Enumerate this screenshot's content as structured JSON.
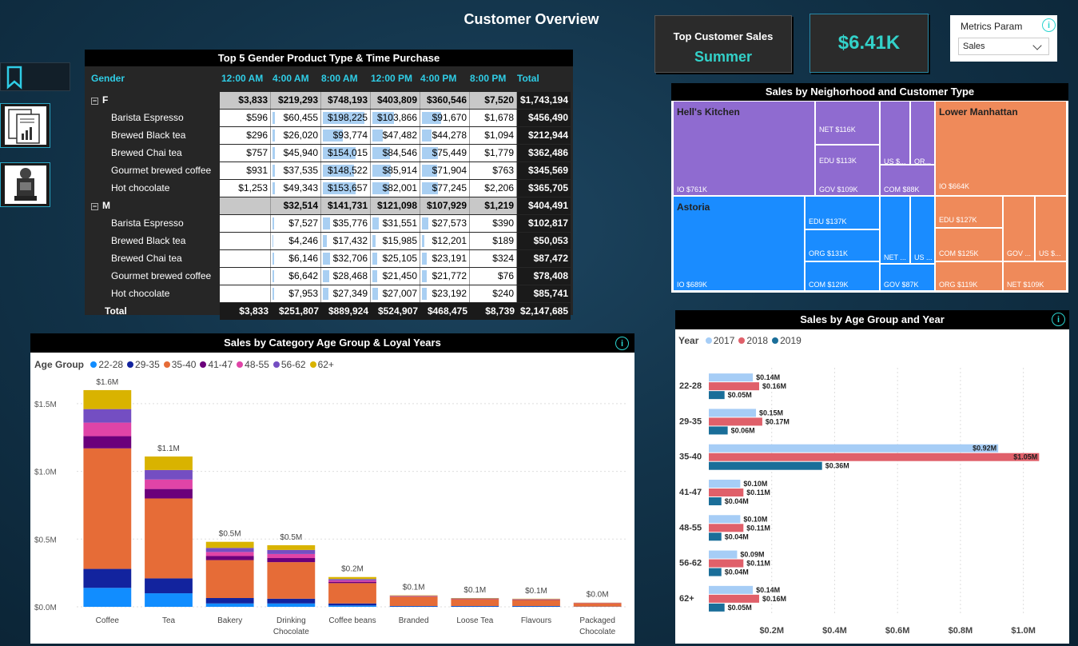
{
  "page_title": "Customer Overview",
  "kpi": {
    "top_customer_label": "Top Customer Sales",
    "top_customer_value": "Summer",
    "amount": "$6.41K"
  },
  "metrics_param": {
    "label": "Metrics Param",
    "selected": "Sales"
  },
  "matrix": {
    "title": "Top 5 Gender Product Type & Time Purchase",
    "row_header": "Gender",
    "columns": [
      "12:00 AM",
      "4:00 AM",
      "8:00 AM",
      "12:00 PM",
      "4:00 PM",
      "8:00 PM",
      "Total"
    ],
    "groups": [
      {
        "name": "F",
        "totals": [
          "$3,833",
          "$219,293",
          "$748,193",
          "$403,809",
          "$360,546",
          "$7,520",
          "$1,743,194"
        ],
        "rows": [
          {
            "label": "Barista Espresso",
            "values": [
              "$596",
              "$60,455",
              "$198,225",
              "$103,866",
              "$91,670",
              "$1,678",
              "$456,490"
            ],
            "bars": [
              0,
              0.05,
              0.9,
              0.47,
              0.41,
              0,
              0
            ]
          },
          {
            "label": "Brewed Black tea",
            "values": [
              "$296",
              "$26,020",
              "$93,774",
              "$47,482",
              "$44,278",
              "$1,094",
              "$212,944"
            ],
            "bars": [
              0,
              0.05,
              0.43,
              0.22,
              0.2,
              0,
              0
            ]
          },
          {
            "label": "Brewed Chai tea",
            "values": [
              "$757",
              "$45,940",
              "$154,015",
              "$84,546",
              "$75,449",
              "$1,779",
              "$362,486"
            ],
            "bars": [
              0,
              0.05,
              0.7,
              0.38,
              0.34,
              0,
              0
            ]
          },
          {
            "label": "Gourmet brewed coffee",
            "values": [
              "$931",
              "$37,535",
              "$148,522",
              "$85,914",
              "$71,904",
              "$763",
              "$345,569"
            ],
            "bars": [
              0,
              0.05,
              0.68,
              0.39,
              0.33,
              0,
              0
            ]
          },
          {
            "label": "Hot chocolate",
            "values": [
              "$1,253",
              "$49,343",
              "$153,657",
              "$82,001",
              "$77,245",
              "$2,206",
              "$365,705"
            ],
            "bars": [
              0,
              0.05,
              0.7,
              0.37,
              0.35,
              0,
              0
            ]
          }
        ]
      },
      {
        "name": "M",
        "totals": [
          "",
          "$32,514",
          "$141,731",
          "$121,098",
          "$107,929",
          "$1,219",
          "$404,491"
        ],
        "rows": [
          {
            "label": "Barista Espresso",
            "values": [
              "",
              "$7,527",
              "$35,776",
              "$31,551",
              "$27,573",
              "$390",
              "$102,817"
            ],
            "bars": [
              0,
              0.03,
              0.16,
              0.14,
              0.13,
              0,
              0
            ]
          },
          {
            "label": "Brewed Black tea",
            "values": [
              "",
              "$4,246",
              "$17,432",
              "$15,985",
              "$12,201",
              "$189",
              "$50,053"
            ],
            "bars": [
              0,
              0.02,
              0.08,
              0.07,
              0.06,
              0,
              0
            ]
          },
          {
            "label": "Brewed Chai tea",
            "values": [
              "",
              "$6,146",
              "$32,706",
              "$25,105",
              "$23,191",
              "$324",
              "$87,472"
            ],
            "bars": [
              0,
              0.03,
              0.15,
              0.11,
              0.11,
              0,
              0
            ]
          },
          {
            "label": "Gourmet brewed coffee",
            "values": [
              "",
              "$6,642",
              "$28,468",
              "$21,450",
              "$21,772",
              "$76",
              "$78,408"
            ],
            "bars": [
              0,
              0.03,
              0.13,
              0.1,
              0.1,
              0,
              0
            ]
          },
          {
            "label": "Hot chocolate",
            "values": [
              "",
              "$7,953",
              "$27,349",
              "$27,007",
              "$23,192",
              "$240",
              "$85,741"
            ],
            "bars": [
              0,
              0.04,
              0.12,
              0.12,
              0.11,
              0,
              0
            ]
          }
        ]
      }
    ],
    "total_label": "Total",
    "grand_totals": [
      "$3,833",
      "$251,807",
      "$889,924",
      "$524,907",
      "$468,475",
      "$8,739",
      "$2,147,685"
    ]
  },
  "treemap": {
    "title": "Sales by Neighorhood and Customer Type",
    "areas": [
      {
        "name": "Hell's Kitchen",
        "color": "#8f6bd0",
        "cells": [
          "IO $761K",
          "NET $116K",
          "EDU $113K",
          "GOV $109K",
          "US $...",
          "OR...",
          "COM $88K"
        ]
      },
      {
        "name": "Astoria",
        "color": "#1a8cff",
        "cells": [
          "IO $689K",
          "EDU $137K",
          "ORG $131K",
          "COM $129K",
          "NET ...",
          "US ...",
          "GOV $87K"
        ]
      },
      {
        "name": "Lower Manhattan",
        "color": "#ef8a5a",
        "cells": [
          "IO $664K",
          "EDU $127K",
          "COM $125K",
          "GOV ...",
          "US $...",
          "ORG $119K",
          "NET $109K"
        ]
      }
    ]
  },
  "info_icon": "i",
  "chart_data": [
    {
      "type": "bar",
      "stacked": true,
      "title": "Sales by Category Age Group & Loyal Years",
      "legend_title": "Age Group",
      "legend_position": "top-left",
      "categories": [
        "Coffee",
        "Tea",
        "Bakery",
        "Drinking Chocolate",
        "Coffee beans",
        "Branded",
        "Loose Tea",
        "Flavours",
        "Packaged Chocolate"
      ],
      "totals_labels": [
        "$1.6M",
        "$1.1M",
        "$0.5M",
        "$0.5M",
        "$0.2M",
        "$0.1M",
        "$0.1M",
        "$0.1M",
        "$0.0M"
      ],
      "ylim": [
        0,
        1700000
      ],
      "yticks": [
        "$0.0M",
        "$0.5M",
        "$1.0M",
        "$1.5M"
      ],
      "ytick_values": [
        0,
        500000,
        1000000,
        1500000
      ],
      "grid": true,
      "series": [
        {
          "name": "22-28",
          "color": "#118dff",
          "values": [
            140000,
            100000,
            25000,
            25000,
            10000,
            3000,
            3000,
            3000,
            1000
          ]
        },
        {
          "name": "29-35",
          "color": "#12239e",
          "values": [
            140000,
            110000,
            40000,
            35000,
            15000,
            3000,
            3000,
            3000,
            1000
          ]
        },
        {
          "name": "35-40",
          "color": "#e66c37",
          "values": [
            890000,
            590000,
            280000,
            270000,
            150000,
            70000,
            50000,
            45000,
            25000
          ]
        },
        {
          "name": "41-47",
          "color": "#6b007b",
          "values": [
            90000,
            70000,
            30000,
            30000,
            10000,
            2000,
            2000,
            2000,
            1000
          ]
        },
        {
          "name": "48-55",
          "color": "#e044a7",
          "values": [
            100000,
            70000,
            30000,
            30000,
            10000,
            2000,
            2000,
            2000,
            1000
          ]
        },
        {
          "name": "56-62",
          "color": "#744ec2",
          "values": [
            100000,
            70000,
            30000,
            30000,
            10000,
            2000,
            2000,
            2000,
            1000
          ]
        },
        {
          "name": "62+",
          "color": "#d9b300",
          "values": [
            140000,
            100000,
            45000,
            35000,
            15000,
            3000,
            3000,
            3000,
            1000
          ]
        }
      ]
    },
    {
      "type": "bar",
      "orientation": "horizontal",
      "title": "Sales by Age Group and Year",
      "legend_title": "Year",
      "legend_position": "top-left",
      "categories": [
        "22-28",
        "29-35",
        "35-40",
        "41-47",
        "48-55",
        "56-62",
        "62+"
      ],
      "xlim": [
        0,
        1100000
      ],
      "xticks": [
        "$0.2M",
        "$0.4M",
        "$0.6M",
        "$0.8M",
        "$1.0M"
      ],
      "xtick_values": [
        200000,
        400000,
        600000,
        800000,
        1000000
      ],
      "grid": true,
      "series": [
        {
          "name": "2017",
          "color": "#a6cdf6",
          "values": [
            140000,
            150000,
            920000,
            100000,
            100000,
            90000,
            140000
          ],
          "labels": [
            "$0.14M",
            "$0.15M",
            "$0.92M",
            "$0.10M",
            "$0.10M",
            "$0.09M",
            "$0.14M"
          ]
        },
        {
          "name": "2018",
          "color": "#e0606a",
          "values": [
            160000,
            170000,
            1050000,
            110000,
            110000,
            110000,
            160000
          ],
          "labels": [
            "$0.16M",
            "$0.17M",
            "$1.05M",
            "$0.11M",
            "$0.11M",
            "$0.11M",
            "$0.16M"
          ]
        },
        {
          "name": "2019",
          "color": "#1a6e99",
          "values": [
            50000,
            60000,
            360000,
            40000,
            40000,
            40000,
            50000
          ],
          "labels": [
            "$0.05M",
            "$0.06M",
            "$0.36M",
            "$0.04M",
            "$0.04M",
            "$0.04M",
            "$0.05M"
          ]
        }
      ]
    }
  ]
}
